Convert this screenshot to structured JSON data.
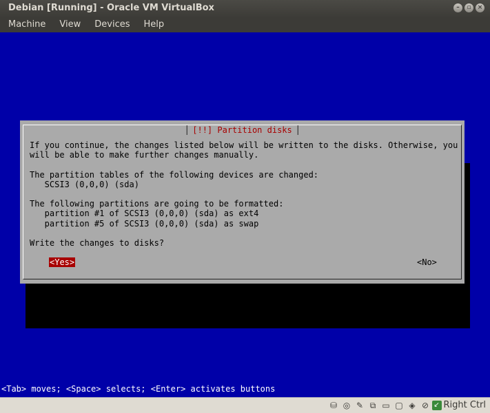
{
  "window": {
    "title": "Debian [Running] - Oracle VM VirtualBox",
    "controls": [
      "–",
      "▫",
      "×"
    ]
  },
  "menu": [
    {
      "label": "Machine"
    },
    {
      "label": "View"
    },
    {
      "label": "Devices"
    },
    {
      "label": "Help"
    }
  ],
  "dialog": {
    "title": "[!!] Partition disks",
    "body": "If you continue, the changes listed below will be written to the disks. Otherwise, you\nwill be able to make further changes manually.\n\nThe partition tables of the following devices are changed:\n   SCSI3 (0,0,0) (sda)\n\nThe following partitions are going to be formatted:\n   partition #1 of SCSI3 (0,0,0) (sda) as ext4\n   partition #5 of SCSI3 (0,0,0) (sda) as swap\n\nWrite the changes to disks?",
    "yes_label": "<Yes>",
    "no_label": "<No>"
  },
  "help_line": "<Tab> moves; <Space> selects; <Enter> activates buttons",
  "statusbar": {
    "icons": [
      "hard-disk-icon",
      "optical-drive-icon",
      "usb-icon",
      "network-icon",
      "shared-folder-icon",
      "display-icon",
      "capture-icon",
      "mouse-integration-icon"
    ],
    "icon_glyphs": [
      "⛁",
      "◎",
      "✎",
      "⧉",
      "▭",
      "▢",
      "◈",
      "⊘"
    ],
    "host_key_label": "Right Ctrl",
    "host_key_glyph": "↙"
  }
}
